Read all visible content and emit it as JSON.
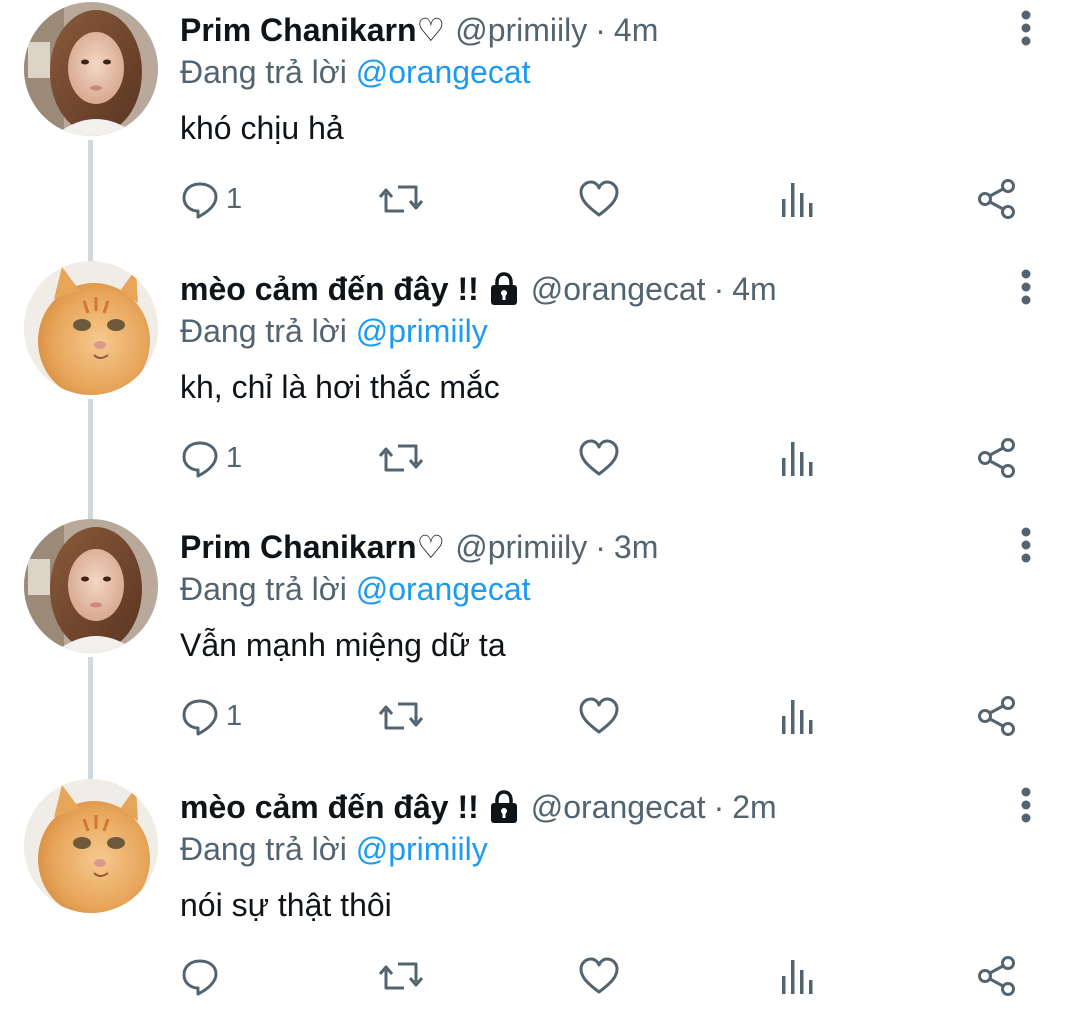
{
  "theme": {
    "text": "#0f1419",
    "secondary": "#536471",
    "link": "#1d9bf0",
    "thread_line": "#cfd9de",
    "icon": "#536471"
  },
  "tweets": [
    {
      "display_name": "Prim Chanikarn♡",
      "handle": "@primiily",
      "dot": "·",
      "time": "4m",
      "reply_prefix": "Đang trả lời",
      "reply_to": "@orangecat",
      "text": "khó chịu hả",
      "reply_count": "1",
      "protected": false,
      "avatar": "person-photo"
    },
    {
      "display_name": "mèo cảm đến đây !!",
      "handle": "@orangecat",
      "dot": "·",
      "time": "4m",
      "reply_prefix": "Đang trả lời",
      "reply_to": "@primiily",
      "text": "kh, chỉ là hơi thắc mắc",
      "reply_count": "1",
      "protected": true,
      "avatar": "cat-photo"
    },
    {
      "display_name": "Prim Chanikarn♡",
      "handle": "@primiily",
      "dot": "·",
      "time": "3m",
      "reply_prefix": "Đang trả lời",
      "reply_to": "@orangecat",
      "text": "Vẫn mạnh miệng dữ ta",
      "reply_count": "1",
      "protected": false,
      "avatar": "person-photo"
    },
    {
      "display_name": "mèo cảm đến đây !!",
      "handle": "@orangecat",
      "dot": "·",
      "time": "2m",
      "reply_prefix": "Đang trả lời",
      "reply_to": "@primiily",
      "text": "nói sự thật thôi",
      "reply_count": "",
      "protected": true,
      "avatar": "cat-photo"
    }
  ],
  "icons": {
    "reply": "reply-icon",
    "retweet": "retweet-icon",
    "like": "like-icon",
    "views": "views-icon",
    "share": "share-icon",
    "more": "more-vertical-icon",
    "lock": "lock-icon"
  }
}
